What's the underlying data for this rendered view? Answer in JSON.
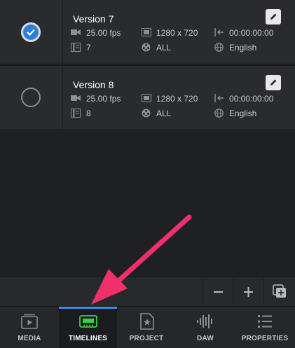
{
  "timelines": [
    {
      "name": "Version 7",
      "selected": true,
      "fps": "25.00 fps",
      "resolution": "1280 x 720",
      "start_timecode": "00:00:00:00",
      "tracks": "7",
      "audio": "ALL",
      "language": "English"
    },
    {
      "name": "Version 8",
      "selected": false,
      "fps": "25.00 fps",
      "resolution": "1280 x 720",
      "start_timecode": "00:00:00:00",
      "tracks": "8",
      "audio": "ALL",
      "language": "English"
    }
  ],
  "toolbar": {
    "buttons": [
      "minus-icon",
      "plus-icon",
      "duplicate-icon"
    ]
  },
  "tabs": [
    {
      "label": "MEDIA",
      "icon": "media-icon",
      "active": false
    },
    {
      "label": "TIMELINES",
      "icon": "timelines-icon",
      "active": true
    },
    {
      "label": "PROJECT",
      "icon": "project-icon",
      "active": false
    },
    {
      "label": "DAW",
      "icon": "daw-icon",
      "active": false
    },
    {
      "label": "PROPERTIES",
      "icon": "properties-icon",
      "active": false
    }
  ],
  "colors": {
    "accent": "#2f7fd9",
    "active_tab_icon": "#37d24a",
    "annotation_arrow": "#f0306a"
  }
}
